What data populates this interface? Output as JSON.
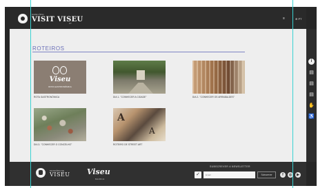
{
  "header": {
    "logo_small": "MUNICÍPIO",
    "logo_title": "VISIT VISEU",
    "language": "PT",
    "menu_icon": "hamburger-icon",
    "lang_icon": "globe-icon"
  },
  "main": {
    "section_title": "ROTEIROS",
    "cards": [
      {
        "caption": "ROTA GASTRONÓMICA",
        "thumb_title": "Viseu",
        "thumb_subtitle": "ROTA GASTRONÓMICA"
      },
      {
        "caption": "DIA 1- \"CONHECER A CIDADE\""
      },
      {
        "caption": "DIA 2- \"CONHECER OS ARRABALDES\""
      },
      {
        "caption": "DIA 3- \"CONHECER O CONCELHO\""
      },
      {
        "caption": "ROTEIRO DE STREET ART",
        "thumb_letters": "A"
      }
    ]
  },
  "sidebar": {
    "icons": [
      "info-icon",
      "calendar-icon",
      "calendar-icon",
      "calendar-icon",
      "hand-icon",
      "accessibility-icon"
    ]
  },
  "footer": {
    "municipio_small": "MUNICÍPIO DE",
    "municipio_name": "VISEU",
    "visit_logo": "Viseu",
    "visit_marca": "MARCA",
    "newsletter_label": "SUBSCREVER A NEWSLETTER",
    "email_placeholder": "Email",
    "subscribe_label": "Subscrever",
    "social": [
      "facebook-icon",
      "instagram-icon",
      "youtube-icon"
    ]
  },
  "colors": {
    "accent": "#6a6fb8",
    "frame": "#262626",
    "guide": "#38d2d2"
  }
}
